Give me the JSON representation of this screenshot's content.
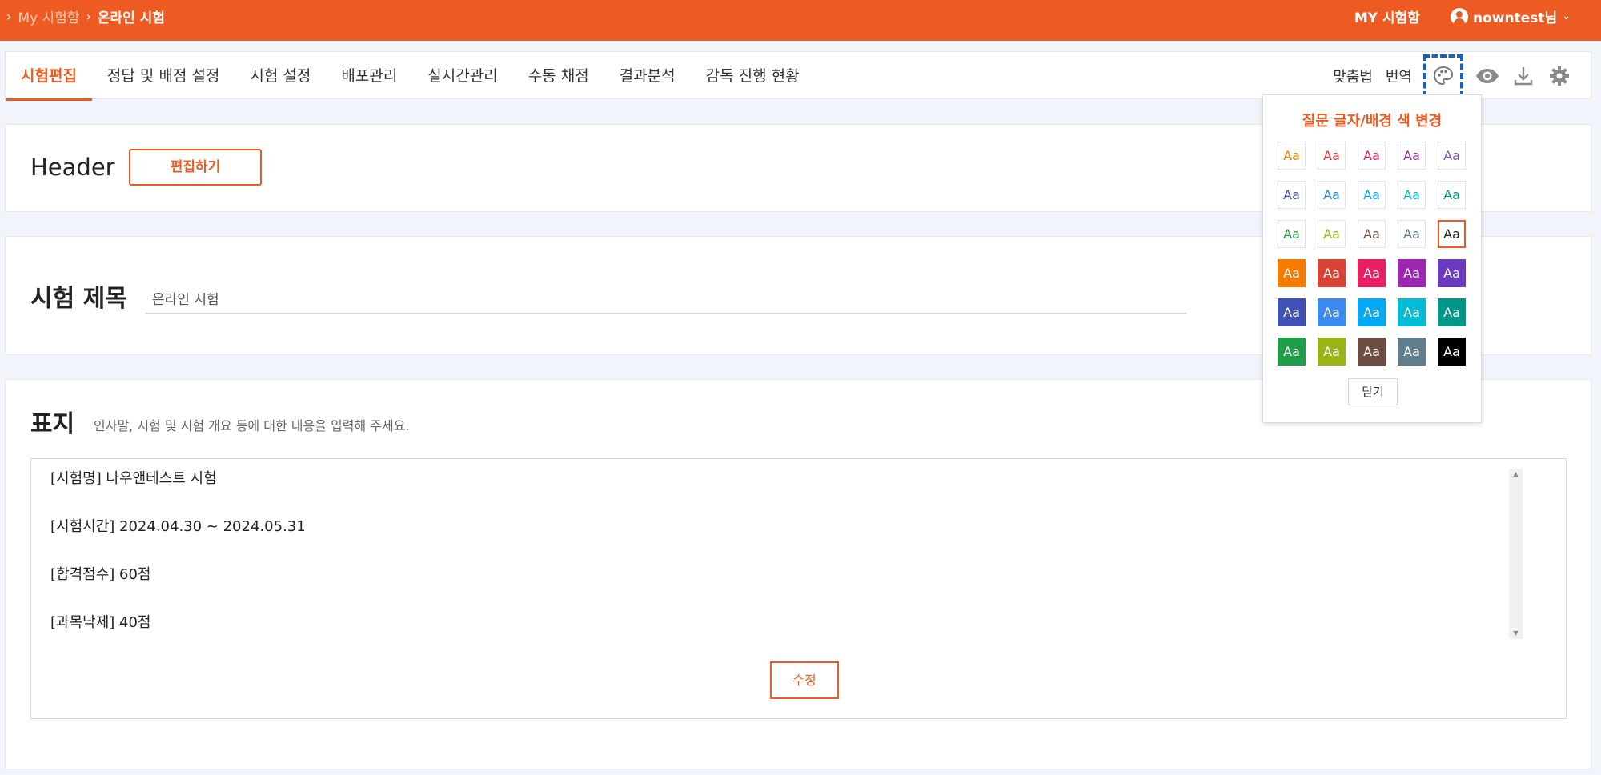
{
  "topbar": {
    "breadcrumb": {
      "parent": "My 시험함",
      "current": "온라인 시험"
    },
    "my_exams": "MY 시험함",
    "user": "nowntest님"
  },
  "tabs": [
    {
      "label": "시험편집",
      "active": true
    },
    {
      "label": "정답 및 배점 설정",
      "active": false
    },
    {
      "label": "시험 설정",
      "active": false
    },
    {
      "label": "배포관리",
      "active": false
    },
    {
      "label": "실시간관리",
      "active": false
    },
    {
      "label": "수동 채점",
      "active": false
    },
    {
      "label": "결과분석",
      "active": false
    },
    {
      "label": "감독 진행 현황",
      "active": false
    }
  ],
  "tools": {
    "spellcheck": "맞춤법",
    "translate": "번역",
    "icons": [
      "palette-icon",
      "eye-icon",
      "download-icon",
      "gear-icon"
    ]
  },
  "header_section": {
    "label": "Header",
    "edit_button": "편집하기"
  },
  "title_section": {
    "label": "시험 제목",
    "value": "온라인 시험"
  },
  "cover_section": {
    "label": "표지",
    "hint": "인사말, 시험 및 시험 개요 등에 대한 내용을 입력해 주세요.",
    "lines": [
      "[시험명] 나우앤테스트 시험",
      "[시험시간] 2024.04.30 ~ 2024.05.31",
      "[합격점수] 60점",
      "[과목낙제] 40점"
    ],
    "edit_button": "수정"
  },
  "color_popover": {
    "title": "질문 글자/배경 색 변경",
    "swatch_label": "Aa",
    "close": "닫기",
    "selected": "#212121",
    "text_colors": [
      "#f57c00",
      "#e53935",
      "#e91e63",
      "#9c27b0",
      "#7e57c2",
      "#3f51b5",
      "#1e88e5",
      "#03a9f4",
      "#00bcd4",
      "#009688",
      "#2e9e48",
      "#9ab317",
      "#795548",
      "#607d8b",
      "#212121"
    ],
    "bg_colors": [
      "#f57c00",
      "#d84335",
      "#e91e63",
      "#9c27b0",
      "#6a3bbf",
      "#3f51b5",
      "#3b8af0",
      "#03a9f4",
      "#00bcd4",
      "#009688",
      "#1e9e48",
      "#9ab317",
      "#6d4c41",
      "#607d8b",
      "#000000"
    ],
    "accent": "#ed5b22"
  }
}
